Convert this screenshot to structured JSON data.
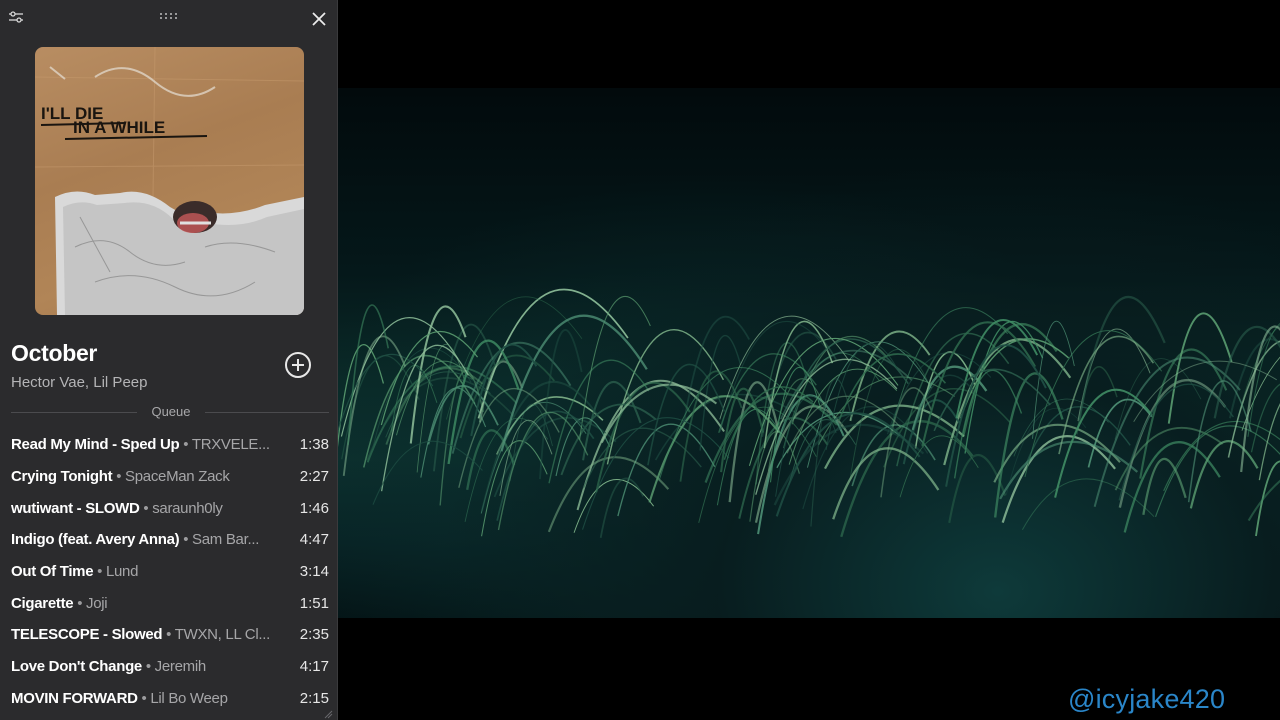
{
  "player": {
    "track": {
      "title": "October",
      "artist": "Hector Vae, Lil Peep"
    },
    "cover": {
      "text_line1": "I'LL DIE",
      "text_line2": "IN A WHILE"
    },
    "queue_label": "Queue",
    "queue": [
      {
        "song": "Read My Mind - Sped Up",
        "sep": " • ",
        "artist": "TRXVELE...",
        "duration": "1:38"
      },
      {
        "song": "Crying Tonight",
        "sep": " • ",
        "artist": "SpaceMan Zack",
        "duration": "2:27"
      },
      {
        "song": "wutiwant - SLOWD",
        "sep": " • ",
        "artist": "saraunh0ly",
        "duration": "1:46"
      },
      {
        "song": "Indigo (feat. Avery Anna)",
        "sep": " • ",
        "artist": "Sam Bar...",
        "duration": "4:47"
      },
      {
        "song": "Out Of Time",
        "sep": " • ",
        "artist": "Lund",
        "duration": "3:14"
      },
      {
        "song": "Cigarette",
        "sep": " • ",
        "artist": "Joji",
        "duration": "1:51"
      },
      {
        "song": "TELESCOPE - Slowed",
        "sep": " • ",
        "artist": "TWXN, LL Cl...",
        "duration": "2:35"
      },
      {
        "song": "Love Don't Change",
        "sep": " • ",
        "artist": "Jeremih",
        "duration": "4:17"
      },
      {
        "song": "MOVIN FORWARD",
        "sep": " • ",
        "artist": "Lil Bo Weep",
        "duration": "2:15"
      }
    ],
    "icons": {
      "settings": "sliders-icon",
      "drag": "drag-handle-icon",
      "close": "close-icon",
      "add": "plus-circle-icon",
      "resize": "resize-grip-icon"
    }
  },
  "watermark": "@icyjake420",
  "colors": {
    "panel_bg": "#2b2b2d",
    "watermark": "#2a86c9",
    "background": "#000000"
  }
}
